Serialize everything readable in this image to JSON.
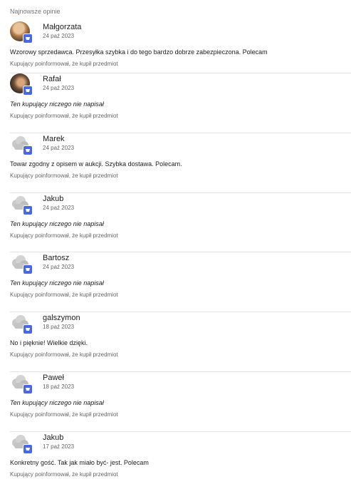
{
  "section_title": "Najnowsze opinie",
  "reviews": [
    {
      "name": "Małgorzata",
      "date": "24 paź 2023",
      "text": "Wzorowy sprzedawca. Przesyłka szybka i do tego bardzo dobrze zabezpieczona. Polecam",
      "info": "Kupujący poinformował, że kupił przedmiot",
      "avatar": "photo1",
      "empty": false
    },
    {
      "name": "Rafał",
      "date": "24 paź 2023",
      "text": "Ten kupujący niczego nie napisał",
      "info": "Kupujący poinformował, że kupił przedmiot",
      "avatar": "photo2",
      "empty": true
    },
    {
      "name": "Marek",
      "date": "24 paź 2023",
      "text": "Towar zgodny z opisem w aukcji. Szybka dostawa. Polecam.",
      "info": "Kupujący poinformował, że kupił przedmiot",
      "avatar": "default",
      "empty": false
    },
    {
      "name": "Jakub",
      "date": "24 paź 2023",
      "text": "Ten kupujący niczego nie napisał",
      "info": "Kupujący poinformował, że kupił przedmiot",
      "avatar": "default",
      "empty": true
    },
    {
      "name": "Bartosz",
      "date": "24 paź 2023",
      "text": "Ten kupujący niczego nie napisał",
      "info": "Kupujący poinformował, że kupił przedmiot",
      "avatar": "default",
      "empty": true
    },
    {
      "name": "galszymon",
      "date": "18 paź 2023",
      "text": "No i pięknie! Wielkie dzięki.",
      "info": "Kupujący poinformował, że kupił przedmiot",
      "avatar": "default",
      "empty": false
    },
    {
      "name": "Paweł",
      "date": "18 paź 2023",
      "text": "Ten kupujący niczego nie napisał",
      "info": "Kupujący poinformował, że kupił przedmiot",
      "avatar": "default",
      "empty": true
    },
    {
      "name": "Jakub",
      "date": "17 paź 2023",
      "text": "Konkretny gość. Tak jak miało być- jest. Polecam",
      "info": "Kupujący poinformował, że kupił przedmiot",
      "avatar": "default",
      "empty": false
    }
  ],
  "colors": {
    "badge": "#4a68e2",
    "divider": "#e4e4e4"
  },
  "icons": {
    "default_avatar": "cloud-avatar-icon",
    "badge": "buyer-cart-icon"
  }
}
